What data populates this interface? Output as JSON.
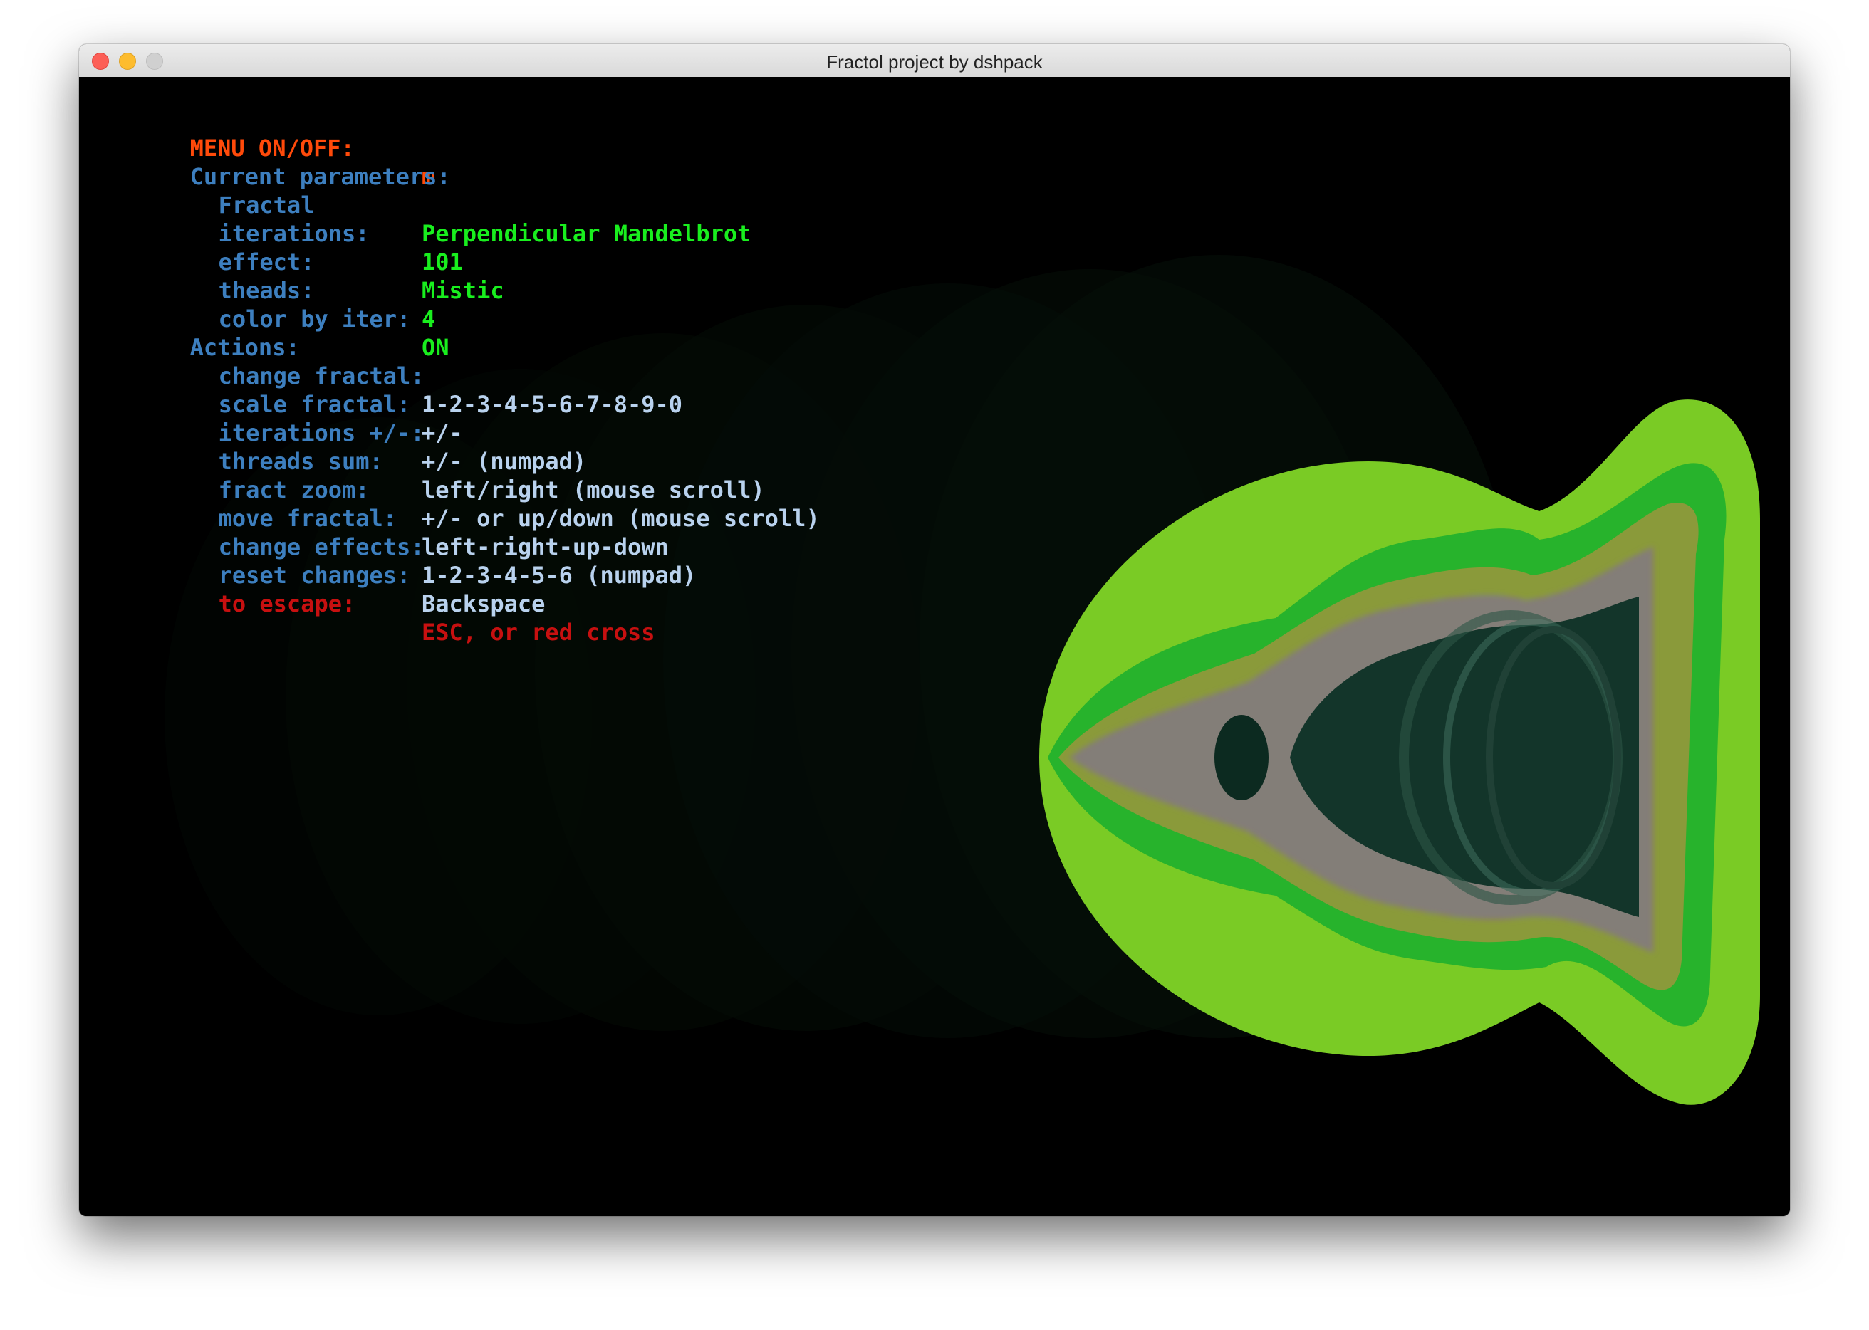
{
  "window": {
    "title": "Fractol project by dshpack"
  },
  "colors": {
    "header": "#ff4a0a",
    "key": "#3d7fbf",
    "param_value": "#19ee1e",
    "action_value": "#b9d2ee",
    "escape": "#c71010"
  },
  "menu": {
    "toggle": {
      "label": "MENU ON/OFF:",
      "value": "m"
    },
    "params_heading": "Current parameters:",
    "params": [
      {
        "label": "Fractal",
        "value": "Perpendicular Mandelbrot"
      },
      {
        "label": "iterations:",
        "value": "101"
      },
      {
        "label": "effect:",
        "value": "Mistic"
      },
      {
        "label": "theads:",
        "value": "4"
      },
      {
        "label": "color by iter:",
        "value": "ON"
      }
    ],
    "actions_heading": "Actions:",
    "actions": [
      {
        "label": "change fractal:",
        "value": "1-2-3-4-5-6-7-8-9-0"
      },
      {
        "label": "scale fractal:",
        "value": "+/-"
      },
      {
        "label": "iterations +/-:",
        "value": "+/- (numpad)"
      },
      {
        "label": "threads sum:",
        "value": "left/right (mouse scroll)"
      },
      {
        "label": "fract zoom:",
        "value": "+/- or up/down (mouse scroll)"
      },
      {
        "label": "move fractal:",
        "value": "left-right-up-down"
      },
      {
        "label": "change effects:",
        "value": "1-2-3-4-5-6 (numpad)"
      },
      {
        "label": "reset changes:",
        "value": "Backspace"
      }
    ],
    "escape": {
      "label": "to escape:",
      "value": "ESC, or red cross"
    }
  }
}
